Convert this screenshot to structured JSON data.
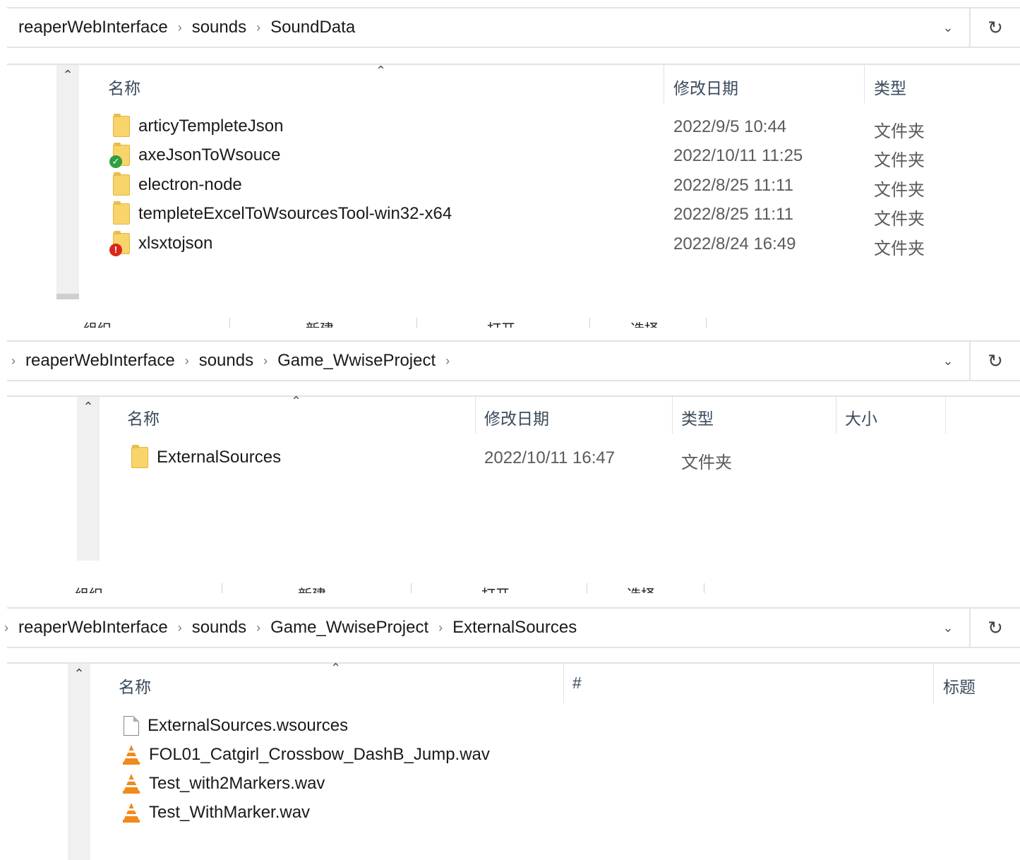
{
  "window1": {
    "breadcrumb": [
      "reaperWebInterface",
      "sounds",
      "SoundData"
    ],
    "columns": {
      "name": "名称",
      "modified": "修改日期",
      "type": "类型"
    },
    "rows": [
      {
        "name": "articyTempleteJson",
        "modified": "2022/9/5 10:44",
        "type": "文件夹",
        "status": ""
      },
      {
        "name": "axeJsonToWsouce",
        "modified": "2022/10/11 11:25",
        "type": "文件夹",
        "status": "ok"
      },
      {
        "name": "electron-node",
        "modified": "2022/8/25 11:11",
        "type": "文件夹",
        "status": ""
      },
      {
        "name": "templeteExcelToWsourcesTool-win32-x64",
        "modified": "2022/8/25 11:11",
        "type": "文件夹",
        "status": ""
      },
      {
        "name": "xlsxtojson",
        "modified": "2022/8/24 16:49",
        "type": "文件夹",
        "status": "error"
      }
    ]
  },
  "toolbar_labels": [
    "组织",
    "新建",
    "打开",
    "选择"
  ],
  "window2": {
    "breadcrumb": [
      "reaperWebInterface",
      "sounds",
      "Game_WwiseProject"
    ],
    "columns": {
      "name": "名称",
      "modified": "修改日期",
      "type": "类型",
      "size": "大小"
    },
    "rows": [
      {
        "name": "ExternalSources",
        "modified": "2022/10/11 16:47",
        "type": "文件夹"
      }
    ]
  },
  "window3": {
    "breadcrumb": [
      "reaperWebInterface",
      "sounds",
      "Game_WwiseProject",
      "ExternalSources"
    ],
    "columns": {
      "name": "名称",
      "number": "#",
      "title": "标题"
    },
    "rows": [
      {
        "name": "ExternalSources.wsources",
        "kind": "file"
      },
      {
        "name": "FOL01_Catgirl_Crossbow_DashB_Jump.wav",
        "kind": "vlc"
      },
      {
        "name": "Test_with2Markers.wav",
        "kind": "vlc"
      },
      {
        "name": "Test_WithMarker.wav",
        "kind": "vlc"
      }
    ]
  },
  "icons": {
    "chevron": "chevron-right-icon",
    "dropdown": "chevron-down-icon",
    "refresh": "refresh-icon",
    "sort": "sort-up-icon",
    "scroll_up": "scroll-up-icon"
  },
  "colors": {
    "folder": "#f8d46a",
    "ok_badge": "#2e9e3e",
    "error_badge": "#d8281e",
    "vlc": "#f08a1c"
  }
}
